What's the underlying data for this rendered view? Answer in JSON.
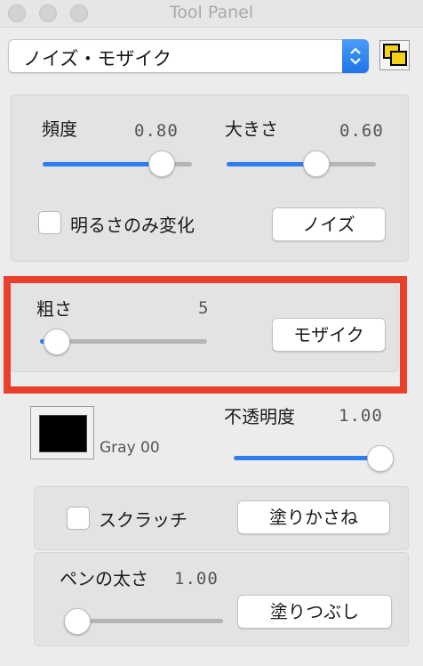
{
  "window": {
    "title": "Tool Panel"
  },
  "popup": {
    "selected": "ノイズ・モザイク"
  },
  "noise": {
    "frequency_label": "頻度",
    "frequency_value": "0.80",
    "frequency": 0.8,
    "size_label": "大きさ",
    "size_value": "0.60",
    "size": 0.6,
    "brightness_only_label": "明るさのみ変化",
    "brightness_only_checked": false,
    "button_label": "ノイズ"
  },
  "mosaic": {
    "roughness_label": "粗さ",
    "roughness_value": "5",
    "roughness_fraction": 0.1,
    "button_label": "モザイク"
  },
  "color": {
    "swatch_color": "#000000",
    "name": "Gray 00",
    "opacity_label": "不透明度",
    "opacity_value": "1.00",
    "opacity": 1.0
  },
  "scratch": {
    "checkbox_label": "スクラッチ",
    "checked": false,
    "overlay_button_label": "塗りかさね"
  },
  "pen": {
    "width_label": "ペンの太さ",
    "width_value": "1.00",
    "width_fraction": 0.0,
    "fill_button_label": "塗りつぶし"
  },
  "colors": {
    "accent": "#2f7ef0",
    "highlight": "#e8402b"
  }
}
